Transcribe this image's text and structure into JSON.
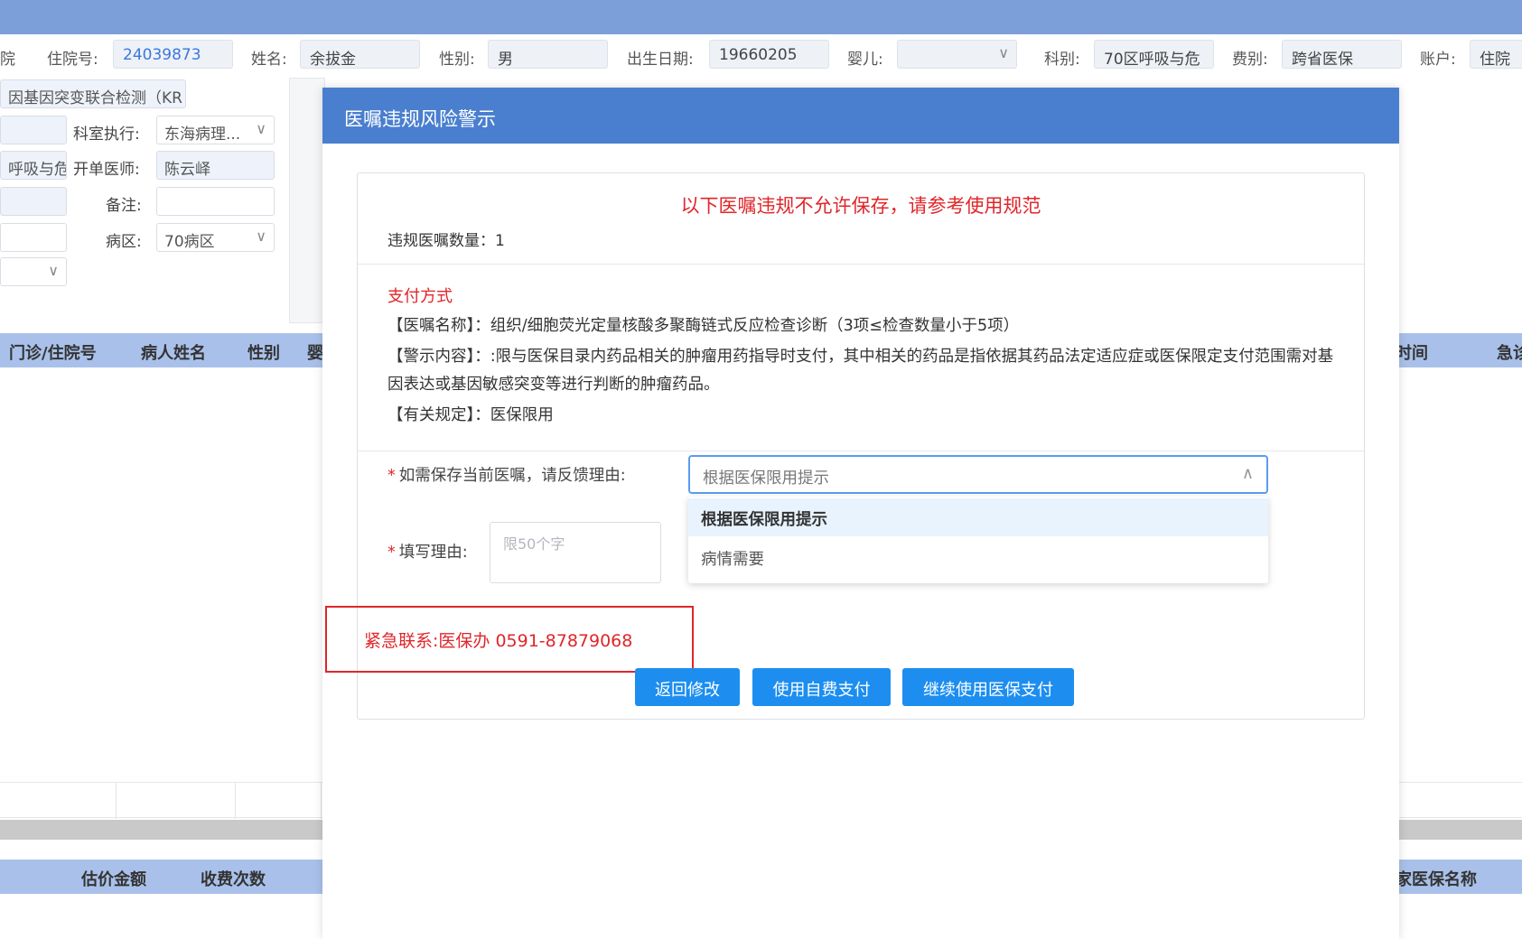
{
  "patient": {
    "dept_fragment": "院",
    "admission_label": "住院号:",
    "admission_no": "24039873",
    "name_label": "姓名:",
    "name": "余拔金",
    "gender_label": "性别:",
    "gender": "男",
    "birth_label": "出生日期:",
    "birth": "19660205",
    "infant_label": "婴儿:",
    "infant": "",
    "dept_label": "科别:",
    "dept": "70区呼吸与危",
    "fee_label": "费别:",
    "fee": "跨省医保",
    "account_label": "账户:",
    "account": "住院"
  },
  "order_form": {
    "test_name": "因基因突变联合检测（KR",
    "exec_label": "科室执行:",
    "exec_value": "东海病理...",
    "dept_fragment": "呼吸与危",
    "doctor_label": "开单医师:",
    "doctor": "陈云峄",
    "remark_label": "备注:",
    "remark": "",
    "ward_label": "病区:",
    "ward": "70病区"
  },
  "table_top": {
    "columns": [
      "门诊/住院号",
      "病人姓名",
      "性别",
      "婴",
      "时间",
      "急诊"
    ]
  },
  "table_bottom": {
    "columns": [
      "估价金额",
      "收费次数",
      "家医保名称"
    ]
  },
  "modal": {
    "title": "医嘱违规风险警示",
    "warning": "以下医嘱违规不允许保存，请参考使用规范",
    "count_label": "违规医嘱数量：",
    "count": "1",
    "section": "支付方式",
    "order_name_label": "【医嘱名称】：",
    "order_name": "组织/细胞荧光定量核酸多聚酶链式反应检查诊断（3项≤检查数量小于5项）",
    "warn_content_label": "【警示内容】：",
    "warn_content": ":限与医保目录内药品相关的肿瘤用药指导时支付，其中相关的药品是指依据其药品法定适应症或医保限定支付范围需对基因表达或基因敏感突变等进行判断的肿瘤药品。",
    "rule_label": "【有关规定】：",
    "rule": "医保限用",
    "reason_select_label": "如需保存当前医嘱，请反馈理由:",
    "reason_select_value": "根据医保限用提示",
    "reason_text_label": "填写理由:",
    "reason_text_placeholder": "限50个字",
    "options": [
      "根据医保限用提示",
      "病情需要"
    ],
    "contact": "紧急联系:医保办 0591-87879068",
    "btn_back": "返回修改",
    "btn_self_pay": "使用自费支付",
    "btn_insurance": "继续使用医保支付",
    "accent_color": "#4a7fcf",
    "alert_color": "#e0262a"
  }
}
